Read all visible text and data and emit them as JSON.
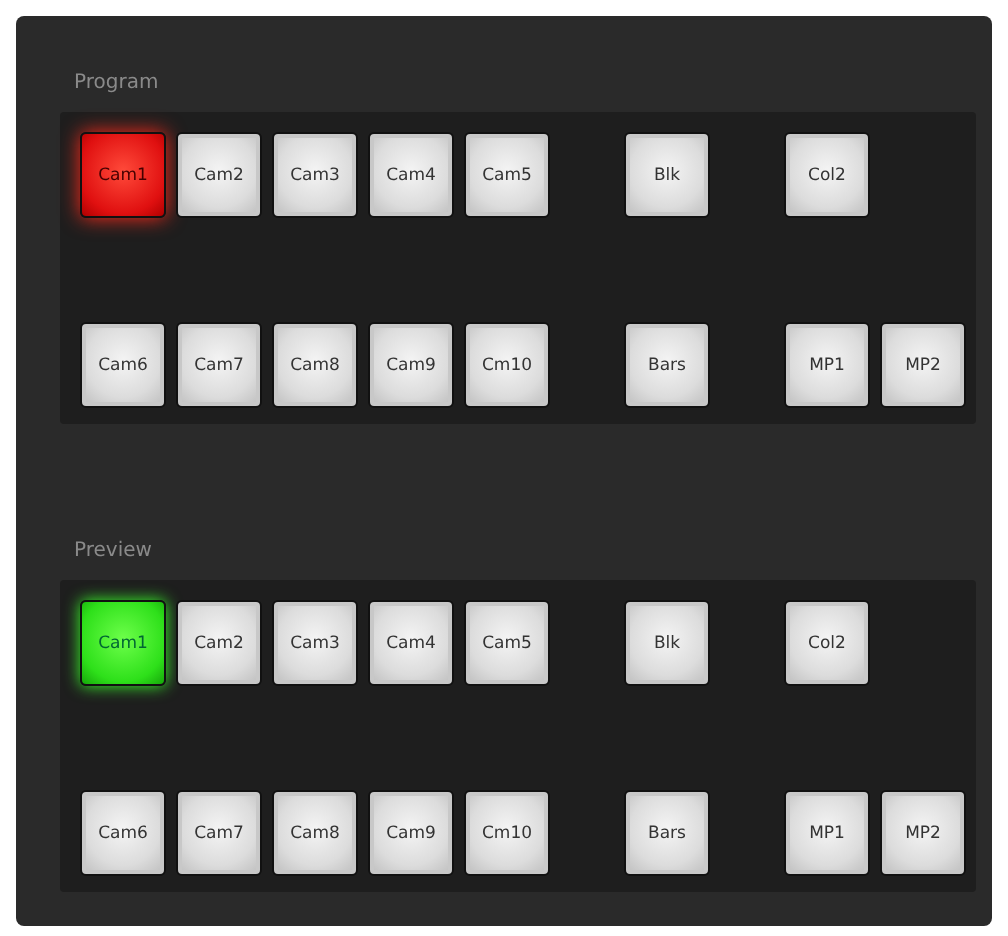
{
  "buses": [
    {
      "label": "Program",
      "kind": "program",
      "rows": [
        {
          "groups": [
            [
              {
                "label": "Cam1",
                "selected": true
              },
              {
                "label": "Cam2",
                "selected": false
              },
              {
                "label": "Cam3",
                "selected": false
              },
              {
                "label": "Cam4",
                "selected": false
              },
              {
                "label": "Cam5",
                "selected": false
              }
            ],
            [
              {
                "label": "Blk",
                "selected": false
              }
            ],
            [
              {
                "label": "Col2",
                "selected": false
              }
            ]
          ]
        },
        {
          "groups": [
            [
              {
                "label": "Cam6",
                "selected": false
              },
              {
                "label": "Cam7",
                "selected": false
              },
              {
                "label": "Cam8",
                "selected": false
              },
              {
                "label": "Cam9",
                "selected": false
              },
              {
                "label": "Cm10",
                "selected": false
              }
            ],
            [
              {
                "label": "Bars",
                "selected": false
              }
            ],
            [
              {
                "label": "MP1",
                "selected": false
              },
              {
                "label": "MP2",
                "selected": false
              }
            ]
          ]
        }
      ]
    },
    {
      "label": "Preview",
      "kind": "preview",
      "rows": [
        {
          "groups": [
            [
              {
                "label": "Cam1",
                "selected": true
              },
              {
                "label": "Cam2",
                "selected": false
              },
              {
                "label": "Cam3",
                "selected": false
              },
              {
                "label": "Cam4",
                "selected": false
              },
              {
                "label": "Cam5",
                "selected": false
              }
            ],
            [
              {
                "label": "Blk",
                "selected": false
              }
            ],
            [
              {
                "label": "Col2",
                "selected": false
              }
            ]
          ]
        },
        {
          "groups": [
            [
              {
                "label": "Cam6",
                "selected": false
              },
              {
                "label": "Cam7",
                "selected": false
              },
              {
                "label": "Cam8",
                "selected": false
              },
              {
                "label": "Cam9",
                "selected": false
              },
              {
                "label": "Cm10",
                "selected": false
              }
            ],
            [
              {
                "label": "Bars",
                "selected": false
              }
            ],
            [
              {
                "label": "MP1",
                "selected": false
              },
              {
                "label": "MP2",
                "selected": false
              }
            ]
          ]
        }
      ]
    }
  ]
}
